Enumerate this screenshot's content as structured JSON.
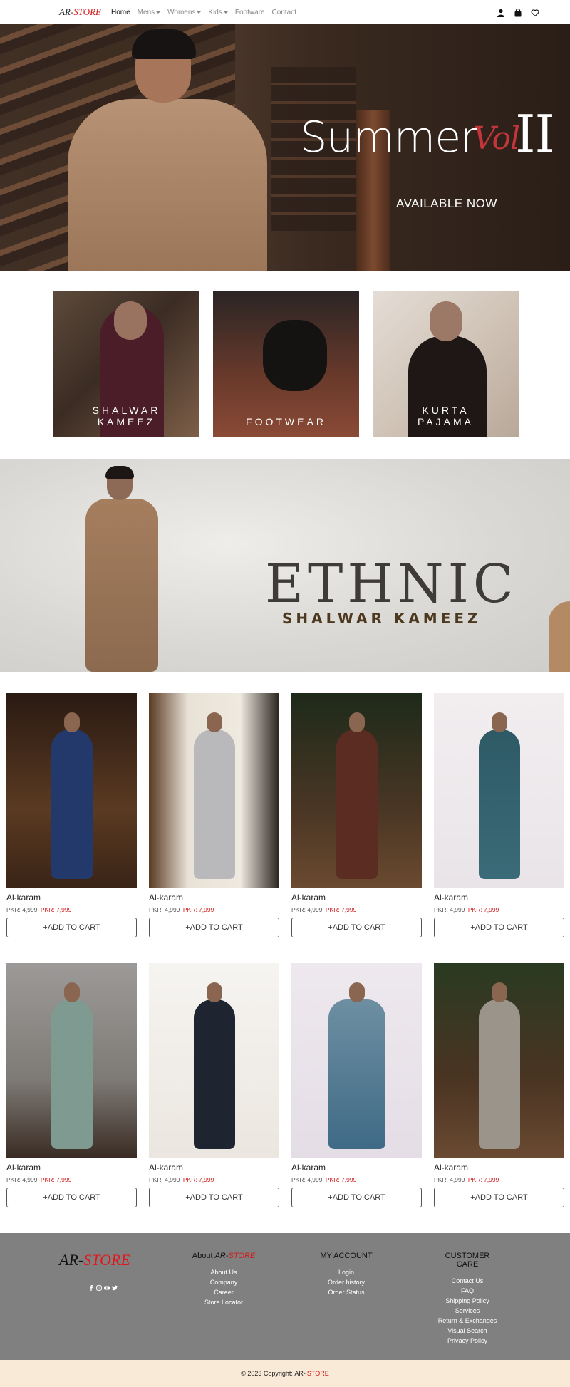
{
  "nav": {
    "brand_prefix": "AR-",
    "brand_suffix": "STORE",
    "links": [
      {
        "label": "Home",
        "dropdown": false,
        "active": true
      },
      {
        "label": "Mens",
        "dropdown": true,
        "active": false
      },
      {
        "label": "Womens",
        "dropdown": true,
        "active": false
      },
      {
        "label": "Kids",
        "dropdown": true,
        "active": false
      },
      {
        "label": "Footware",
        "dropdown": false,
        "active": false
      },
      {
        "label": "Contact",
        "dropdown": false,
        "active": false
      }
    ],
    "icons": [
      "user-icon",
      "shopping-bag-icon",
      "heart-icon"
    ]
  },
  "hero": {
    "title": "Summer",
    "vol": "Vol",
    "roman": "II",
    "subtitle": "AVAILABLE NOW"
  },
  "categories": [
    {
      "label": "SHALWAR\nKAMEEZ"
    },
    {
      "label": "FOOTWEAR"
    },
    {
      "label": "KURTA\nPAJAMA"
    }
  ],
  "banner": {
    "title": "ETHNIC",
    "subtitle": "SHALWAR KAMEEZ"
  },
  "products": {
    "row1": [
      {
        "name": "Al-karam",
        "price": "PKR: 4,999",
        "old_price": "PKR: 7,999",
        "button": "+ADD TO CART"
      },
      {
        "name": "Al-karam",
        "price": "PKR: 4,999",
        "old_price": "PKR: 7,999",
        "button": "+ADD TO CART"
      },
      {
        "name": "Al-karam",
        "price": "PKR: 4,999",
        "old_price": "PKR: 7,999",
        "button": "+ADD TO CART"
      },
      {
        "name": "Al-karam",
        "price": "PKR: 4,999",
        "old_price": "PKR: 7,999",
        "button": "+ADD TO CART"
      }
    ],
    "row2": [
      {
        "name": "Al-karam",
        "price": "PKR: 4,999",
        "old_price": "PKR: 7,999",
        "button": "+ADD TO CART"
      },
      {
        "name": "Al-karam",
        "price": "PKR: 4,999",
        "old_price": "PKR: 7,999",
        "button": "+ADD TO CART"
      },
      {
        "name": "Al-karam",
        "price": "PKR: 4,999",
        "old_price": "PKR: 7,999",
        "button": "+ADD TO CART"
      },
      {
        "name": "Al-karam",
        "price": "PKR: 4,999",
        "old_price": "PKR: 7,999",
        "button": "+ADD TO CART"
      }
    ]
  },
  "footer": {
    "brand_prefix": "AR-",
    "brand_suffix": "STORE",
    "social_icons": [
      "facebook-icon",
      "instagram-icon",
      "youtube-icon",
      "twitter-icon"
    ],
    "about": {
      "heading_prefix": "About ",
      "heading_brand_prefix": "AR-",
      "heading_brand_suffix": "STORE",
      "links": [
        "About Us",
        "Company",
        "Career",
        "Store Locator"
      ]
    },
    "account": {
      "heading": "MY ACCOUNT",
      "links": [
        "Login",
        "Order history",
        "Order Status"
      ]
    },
    "care": {
      "heading": "CUSTOMER CARE",
      "links": [
        "Contact Us",
        "FAQ",
        "Shipping Policy",
        "Services",
        "Return & Exchanges",
        "Visual Search",
        "Privacy Policy"
      ]
    }
  },
  "copyright": {
    "text": "© 2023 Copyright:",
    "brand_prefix": "AR-",
    "brand_suffix": "STORE"
  },
  "colors": {
    "accent_red": "#d11a1a",
    "footer_bg": "#808080",
    "copyright_bg": "#f8ead6"
  }
}
